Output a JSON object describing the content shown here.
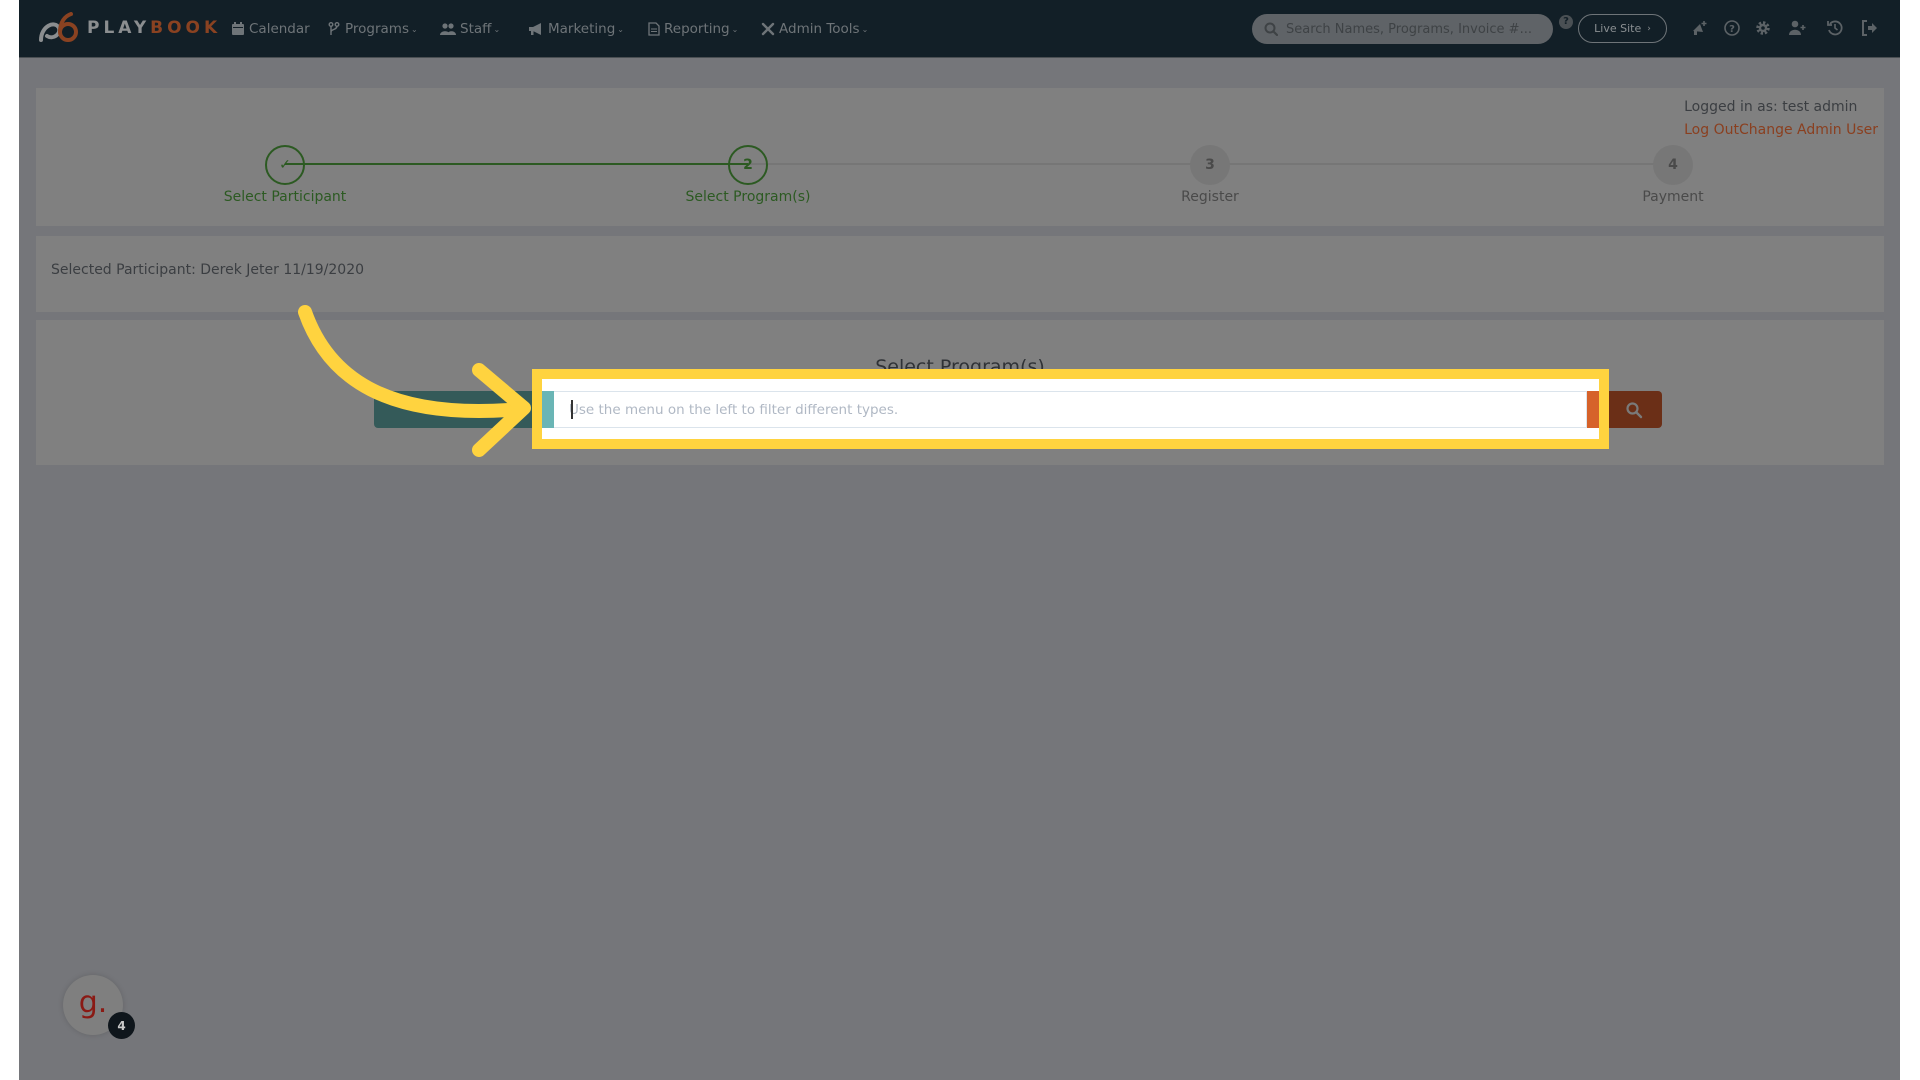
{
  "app": {
    "brand_part1": "PLAY",
    "brand_part2": "BOOK",
    "brand_colors": {
      "nav_bg": "#121f27",
      "accent_orange": "#d6622a",
      "success_green": "#2c5a22",
      "teal": "#345a59",
      "highlight_yellow": "#ffd33f"
    }
  },
  "nav": {
    "items": [
      {
        "label": "Calendar",
        "icon": "calendar-icon",
        "has_dropdown": false
      },
      {
        "label": "Programs",
        "icon": "branch-icon",
        "has_dropdown": true
      },
      {
        "label": "Staff",
        "icon": "users-icon",
        "has_dropdown": true
      },
      {
        "label": "Marketing",
        "icon": "bullhorn-icon",
        "has_dropdown": true
      },
      {
        "label": "Reporting",
        "icon": "document-icon",
        "has_dropdown": true
      },
      {
        "label": "Admin Tools",
        "icon": "tools-icon",
        "has_dropdown": true
      }
    ],
    "caret": "⌄",
    "search_placeholder": "Search Names, Programs, Invoice #...",
    "search_help": "?",
    "live_site_label": "Live Site",
    "live_site_chevron": "›",
    "icons": [
      "announcement-icon",
      "help-icon",
      "settings-icon",
      "add-user-icon",
      "history-icon",
      "logout-icon"
    ]
  },
  "login": {
    "logged_in_text": "Logged in as: test admin",
    "log_out_label": "Log Out",
    "change_admin_label": "Change Admin User"
  },
  "stepper": {
    "steps": [
      {
        "number": "✓",
        "label": "Select Participant",
        "state": "done"
      },
      {
        "number": "2",
        "label": "Select Program(s)",
        "state": "active"
      },
      {
        "number": "3",
        "label": "Register",
        "state": "pending"
      },
      {
        "number": "4",
        "label": "Payment",
        "state": "pending"
      }
    ]
  },
  "participant": {
    "text": "Selected Participant: Derek Jeter 11/19/2020"
  },
  "program_select": {
    "heading": "Select Program(s)",
    "input_placeholder": "Use the menu on the left to filter different types.",
    "input_value": ""
  },
  "chat_widget": {
    "glyph": "g.",
    "badge_count": "4"
  }
}
